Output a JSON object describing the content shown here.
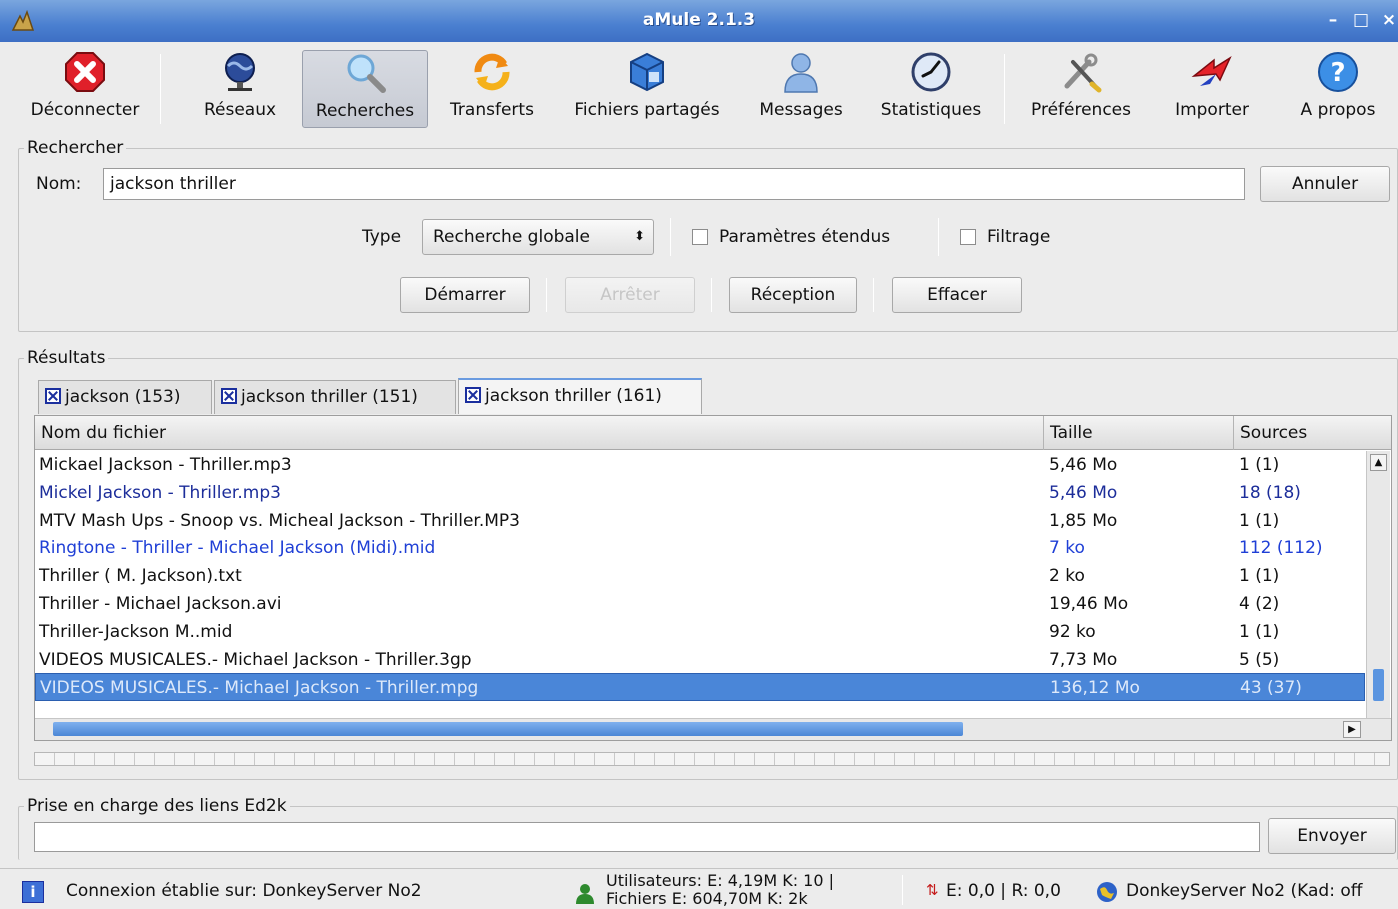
{
  "window": {
    "title": "aMule 2.1.3",
    "controls": [
      "–",
      "□",
      "×"
    ]
  },
  "toolbar": {
    "items": [
      {
        "label": "Déconnecter",
        "icon": "disconnect-icon"
      },
      {
        "label": "Réseaux",
        "icon": "networks-icon"
      },
      {
        "label": "Recherches",
        "icon": "search-icon",
        "active": true
      },
      {
        "label": "Transferts",
        "icon": "transfers-icon"
      },
      {
        "label": "Fichiers partagés",
        "icon": "shared-files-icon"
      },
      {
        "label": "Messages",
        "icon": "messages-icon"
      },
      {
        "label": "Statistiques",
        "icon": "statistics-icon"
      },
      {
        "label": "Préférences",
        "icon": "preferences-icon"
      },
      {
        "label": "Importer",
        "icon": "import-icon"
      },
      {
        "label": "A propos",
        "icon": "about-icon"
      }
    ]
  },
  "search": {
    "group_title": "Rechercher",
    "name_label": "Nom:",
    "name_value": "jackson thriller",
    "cancel_label": "Annuler",
    "type_label": "Type",
    "type_value": "Recherche globale",
    "extended_params_label": "Paramètres étendus",
    "filter_label": "Filtrage",
    "start_label": "Démarrer",
    "stop_label": "Arrêter",
    "receive_label": "Réception",
    "clear_label": "Effacer"
  },
  "results": {
    "group_title": "Résultats",
    "tabs": [
      {
        "label": "jackson (153)"
      },
      {
        "label": "jackson thriller (151)"
      },
      {
        "label": "jackson thriller (161)",
        "active": true
      }
    ],
    "columns": [
      "Nom du fichier",
      "Taille",
      "Sources"
    ],
    "rows": [
      {
        "name": "Mickael Jackson - Thriller.mp3",
        "size": "5,46 Mo",
        "sources": "1 (1)",
        "color": "#111111"
      },
      {
        "name": "Mickel Jackson - Thriller.mp3",
        "size": "5,46 Mo",
        "sources": "18 (18)",
        "color": "#1c2d9a"
      },
      {
        "name": "MTV Mash Ups - Snoop vs. Micheal Jackson - Thriller.MP3",
        "size": "1,85 Mo",
        "sources": "1 (1)",
        "color": "#111111"
      },
      {
        "name": "Ringtone - Thriller - Michael Jackson (Midi).mid",
        "size": "7 ko",
        "sources": "112 (112)",
        "color": "#1f3fd6"
      },
      {
        "name": "Thriller ( M. Jackson).txt",
        "size": "2 ko",
        "sources": "1 (1)",
        "color": "#111111"
      },
      {
        "name": "Thriller - Michael Jackson.avi",
        "size": "19,46 Mo",
        "sources": "4 (2)",
        "color": "#111111"
      },
      {
        "name": "Thriller-Jackson M..mid",
        "size": "92 ko",
        "sources": "1 (1)",
        "color": "#111111"
      },
      {
        "name": "VIDEOS MUSICALES.- Michael Jackson - Thriller.3gp",
        "size": "7,73 Mo",
        "sources": "5 (5)",
        "color": "#111111"
      },
      {
        "name": "VIDEOS MUSICALES.- Michael Jackson - Thriller.mpg",
        "size": "136,12 Mo",
        "sources": "43 (37)",
        "color": "#dde9fa",
        "selected": true
      }
    ],
    "progress": 0
  },
  "ed2k": {
    "group_title": "Prise en charge des liens Ed2k",
    "link_value": "",
    "send_label": "Envoyer"
  },
  "status": {
    "connection": "Connexion établie sur: DonkeyServer No2",
    "users": "Utilisateurs: E: 4,19M K: 10 |",
    "files": "Fichiers E: 604,70M K: 2k",
    "rates": "E: 0,0 | R: 0,0",
    "server": "DonkeyServer No2 (Kad: off"
  }
}
